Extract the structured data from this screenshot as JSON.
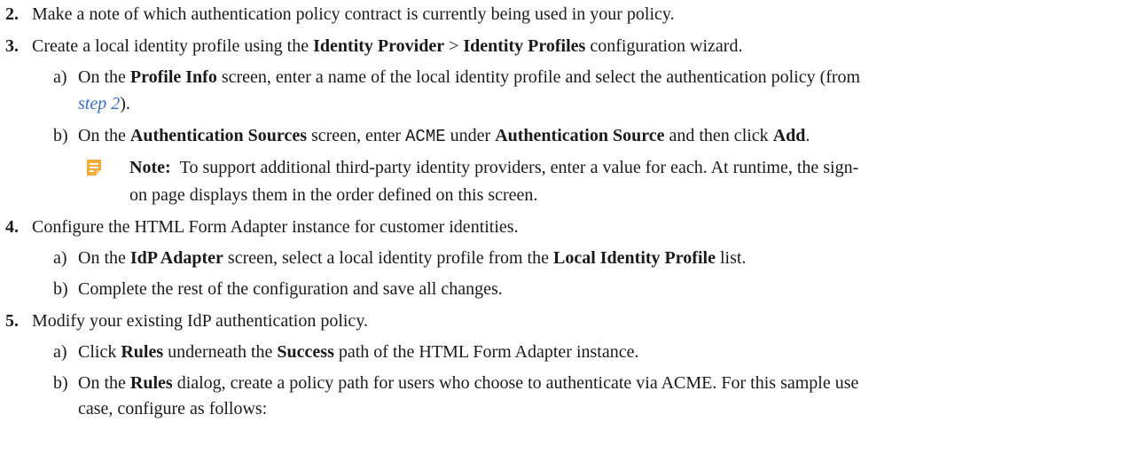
{
  "steps": {
    "s2": {
      "num": "2.",
      "text": "Make a note of which authentication policy contract is currently being used in your policy."
    },
    "s3": {
      "num": "3.",
      "pre": "Create a local identity profile using the ",
      "b1": "Identity Provider",
      "mid": " > ",
      "b2": "Identity Profiles",
      "post": " configuration wizard.",
      "a": {
        "label": "a)",
        "pre": "On the ",
        "b1": "Profile Info",
        "post1": " screen, enter a name of the local identity profile and select the authentication policy (from",
        "link": "step 2",
        "post2": ")."
      },
      "b": {
        "label": "b)",
        "pre": "On the ",
        "b1": "Authentication Sources",
        "mid1": " screen, enter ",
        "code": "ACME",
        "mid2": " under ",
        "b2": "Authentication Source",
        "mid3": " and then click ",
        "b3": "Add",
        "post": "."
      },
      "note": {
        "label": "Note:",
        "line1": "To support additional third-party identity providers, enter a value for each. At runtime, the sign-",
        "line2": "on page displays them in the order defined on this screen."
      }
    },
    "s4": {
      "num": "4.",
      "text": "Configure the HTML Form Adapter instance for customer identities.",
      "a": {
        "label": "a)",
        "pre": "On the ",
        "b1": "IdP Adapter",
        "mid": " screen, select a local identity profile from the ",
        "b2": "Local Identity Profile",
        "post": " list."
      },
      "b": {
        "label": "b)",
        "text": "Complete the rest of the configuration and save all changes."
      }
    },
    "s5": {
      "num": "5.",
      "text": "Modify your existing IdP authentication policy.",
      "a": {
        "label": "a)",
        "pre": "Click ",
        "b1": "Rules",
        "mid": " underneath the ",
        "b2": "Success",
        "post": " path of the HTML Form Adapter instance."
      },
      "b": {
        "label": "b)",
        "pre": "On the ",
        "b1": "Rules",
        "post1": " dialog, create a policy path for users who choose to authenticate via ACME. For this sample use",
        "line2": "case, configure as follows:"
      }
    }
  },
  "colors": {
    "text": "#1a1a1a",
    "link": "#3a6fc4",
    "note_icon": "#f0a93a"
  },
  "icons": {
    "note": "note-icon"
  }
}
